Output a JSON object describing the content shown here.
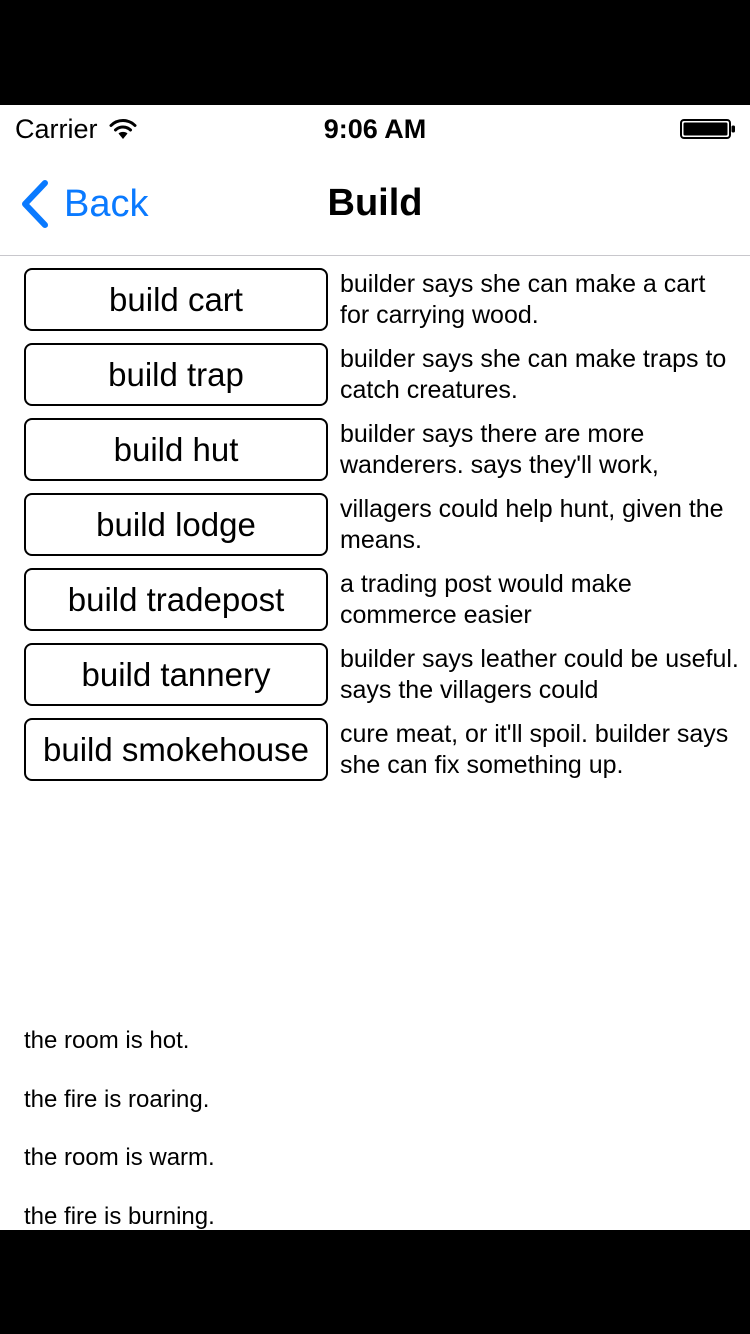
{
  "status_bar": {
    "carrier": "Carrier",
    "time": "9:06 AM"
  },
  "nav": {
    "back_label": "Back",
    "title": "Build",
    "accent_color": "#0a7aff"
  },
  "builds": [
    {
      "label": "build cart",
      "description": "builder says she can make a cart for carrying wood."
    },
    {
      "label": "build trap",
      "description": "builder says she can make traps to catch creatures."
    },
    {
      "label": "build hut",
      "description": "builder says there are more wanderers. says they'll work,"
    },
    {
      "label": "build lodge",
      "description": "villagers could help hunt, given the means."
    },
    {
      "label": "build tradepost",
      "description": "a trading post would make commerce easier"
    },
    {
      "label": "build tannery",
      "description": "builder says leather could be useful. says the villagers could"
    },
    {
      "label": "build smokehouse",
      "description": "cure meat, or it'll spoil. builder says she can fix something up."
    }
  ],
  "notifications": [
    "the room is hot.",
    "the fire is roaring.",
    "the room is warm.",
    "the fire is burning."
  ]
}
